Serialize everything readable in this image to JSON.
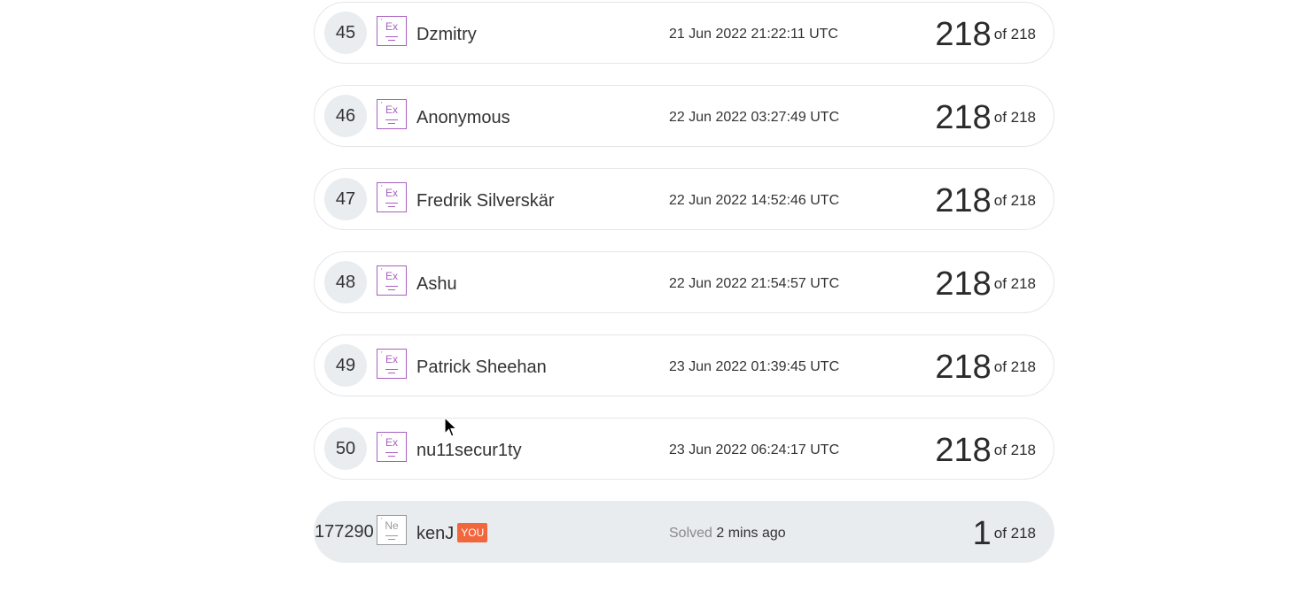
{
  "leaderboard": {
    "rows": [
      {
        "rank": "45",
        "badge": "Ex",
        "name": "Dzmitry",
        "date": "21 Jun 2022 21:22:11 UTC",
        "score": "218",
        "of_label": "of 218"
      },
      {
        "rank": "46",
        "badge": "Ex",
        "name": "Anonymous",
        "date": "22 Jun 2022 03:27:49 UTC",
        "score": "218",
        "of_label": "of 218"
      },
      {
        "rank": "47",
        "badge": "Ex",
        "name": "Fredrik Silverskär",
        "date": "22 Jun 2022 14:52:46 UTC",
        "score": "218",
        "of_label": "of 218"
      },
      {
        "rank": "48",
        "badge": "Ex",
        "name": "Ashu",
        "date": "22 Jun 2022 21:54:57 UTC",
        "score": "218",
        "of_label": "of 218"
      },
      {
        "rank": "49",
        "badge": "Ex",
        "name": "Patrick Sheehan",
        "date": "23 Jun 2022 01:39:45 UTC",
        "score": "218",
        "of_label": "of 218"
      },
      {
        "rank": "50",
        "badge": "Ex",
        "name": "nu11secur1ty",
        "date": "23 Jun 2022 06:24:17 UTC",
        "score": "218",
        "of_label": "of 218"
      }
    ],
    "current_user": {
      "rank": "177290",
      "badge": "Ne",
      "name": "kenJ",
      "you_tag": "YOU",
      "solved_prefix": "Solved",
      "solved_time": "2 mins ago",
      "score": "1",
      "of_label": "of 218"
    }
  },
  "colors": {
    "expert_badge": "#a85fc0",
    "newbie_badge": "#9a9a9a",
    "you_tag": "#f2663c",
    "current_row_bg": "#e8ecee",
    "rank_circle_bg": "#e9edef"
  }
}
